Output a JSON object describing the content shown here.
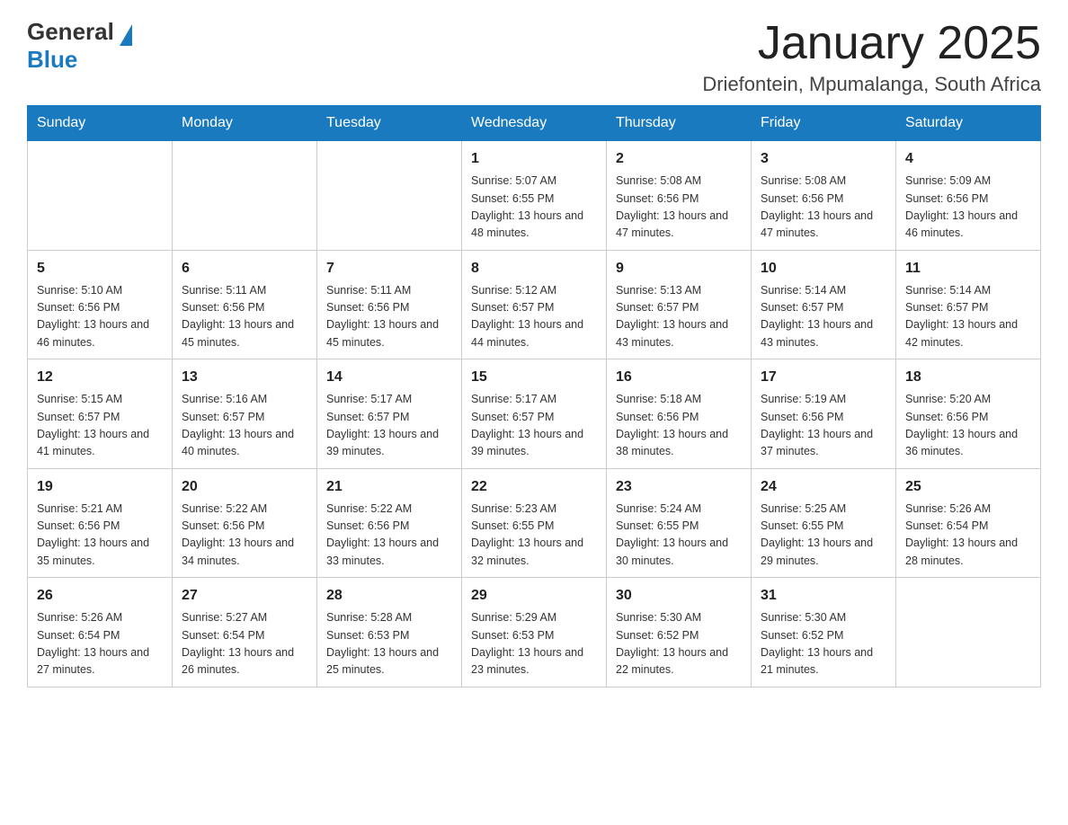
{
  "header": {
    "logo_general": "General",
    "logo_blue": "Blue",
    "month_title": "January 2025",
    "location": "Driefontein, Mpumalanga, South Africa"
  },
  "days_of_week": [
    "Sunday",
    "Monday",
    "Tuesday",
    "Wednesday",
    "Thursday",
    "Friday",
    "Saturday"
  ],
  "weeks": [
    [
      {
        "day": "",
        "info": ""
      },
      {
        "day": "",
        "info": ""
      },
      {
        "day": "",
        "info": ""
      },
      {
        "day": "1",
        "info": "Sunrise: 5:07 AM\nSunset: 6:55 PM\nDaylight: 13 hours and 48 minutes."
      },
      {
        "day": "2",
        "info": "Sunrise: 5:08 AM\nSunset: 6:56 PM\nDaylight: 13 hours and 47 minutes."
      },
      {
        "day": "3",
        "info": "Sunrise: 5:08 AM\nSunset: 6:56 PM\nDaylight: 13 hours and 47 minutes."
      },
      {
        "day": "4",
        "info": "Sunrise: 5:09 AM\nSunset: 6:56 PM\nDaylight: 13 hours and 46 minutes."
      }
    ],
    [
      {
        "day": "5",
        "info": "Sunrise: 5:10 AM\nSunset: 6:56 PM\nDaylight: 13 hours and 46 minutes."
      },
      {
        "day": "6",
        "info": "Sunrise: 5:11 AM\nSunset: 6:56 PM\nDaylight: 13 hours and 45 minutes."
      },
      {
        "day": "7",
        "info": "Sunrise: 5:11 AM\nSunset: 6:56 PM\nDaylight: 13 hours and 45 minutes."
      },
      {
        "day": "8",
        "info": "Sunrise: 5:12 AM\nSunset: 6:57 PM\nDaylight: 13 hours and 44 minutes."
      },
      {
        "day": "9",
        "info": "Sunrise: 5:13 AM\nSunset: 6:57 PM\nDaylight: 13 hours and 43 minutes."
      },
      {
        "day": "10",
        "info": "Sunrise: 5:14 AM\nSunset: 6:57 PM\nDaylight: 13 hours and 43 minutes."
      },
      {
        "day": "11",
        "info": "Sunrise: 5:14 AM\nSunset: 6:57 PM\nDaylight: 13 hours and 42 minutes."
      }
    ],
    [
      {
        "day": "12",
        "info": "Sunrise: 5:15 AM\nSunset: 6:57 PM\nDaylight: 13 hours and 41 minutes."
      },
      {
        "day": "13",
        "info": "Sunrise: 5:16 AM\nSunset: 6:57 PM\nDaylight: 13 hours and 40 minutes."
      },
      {
        "day": "14",
        "info": "Sunrise: 5:17 AM\nSunset: 6:57 PM\nDaylight: 13 hours and 39 minutes."
      },
      {
        "day": "15",
        "info": "Sunrise: 5:17 AM\nSunset: 6:57 PM\nDaylight: 13 hours and 39 minutes."
      },
      {
        "day": "16",
        "info": "Sunrise: 5:18 AM\nSunset: 6:56 PM\nDaylight: 13 hours and 38 minutes."
      },
      {
        "day": "17",
        "info": "Sunrise: 5:19 AM\nSunset: 6:56 PM\nDaylight: 13 hours and 37 minutes."
      },
      {
        "day": "18",
        "info": "Sunrise: 5:20 AM\nSunset: 6:56 PM\nDaylight: 13 hours and 36 minutes."
      }
    ],
    [
      {
        "day": "19",
        "info": "Sunrise: 5:21 AM\nSunset: 6:56 PM\nDaylight: 13 hours and 35 minutes."
      },
      {
        "day": "20",
        "info": "Sunrise: 5:22 AM\nSunset: 6:56 PM\nDaylight: 13 hours and 34 minutes."
      },
      {
        "day": "21",
        "info": "Sunrise: 5:22 AM\nSunset: 6:56 PM\nDaylight: 13 hours and 33 minutes."
      },
      {
        "day": "22",
        "info": "Sunrise: 5:23 AM\nSunset: 6:55 PM\nDaylight: 13 hours and 32 minutes."
      },
      {
        "day": "23",
        "info": "Sunrise: 5:24 AM\nSunset: 6:55 PM\nDaylight: 13 hours and 30 minutes."
      },
      {
        "day": "24",
        "info": "Sunrise: 5:25 AM\nSunset: 6:55 PM\nDaylight: 13 hours and 29 minutes."
      },
      {
        "day": "25",
        "info": "Sunrise: 5:26 AM\nSunset: 6:54 PM\nDaylight: 13 hours and 28 minutes."
      }
    ],
    [
      {
        "day": "26",
        "info": "Sunrise: 5:26 AM\nSunset: 6:54 PM\nDaylight: 13 hours and 27 minutes."
      },
      {
        "day": "27",
        "info": "Sunrise: 5:27 AM\nSunset: 6:54 PM\nDaylight: 13 hours and 26 minutes."
      },
      {
        "day": "28",
        "info": "Sunrise: 5:28 AM\nSunset: 6:53 PM\nDaylight: 13 hours and 25 minutes."
      },
      {
        "day": "29",
        "info": "Sunrise: 5:29 AM\nSunset: 6:53 PM\nDaylight: 13 hours and 23 minutes."
      },
      {
        "day": "30",
        "info": "Sunrise: 5:30 AM\nSunset: 6:52 PM\nDaylight: 13 hours and 22 minutes."
      },
      {
        "day": "31",
        "info": "Sunrise: 5:30 AM\nSunset: 6:52 PM\nDaylight: 13 hours and 21 minutes."
      },
      {
        "day": "",
        "info": ""
      }
    ]
  ]
}
